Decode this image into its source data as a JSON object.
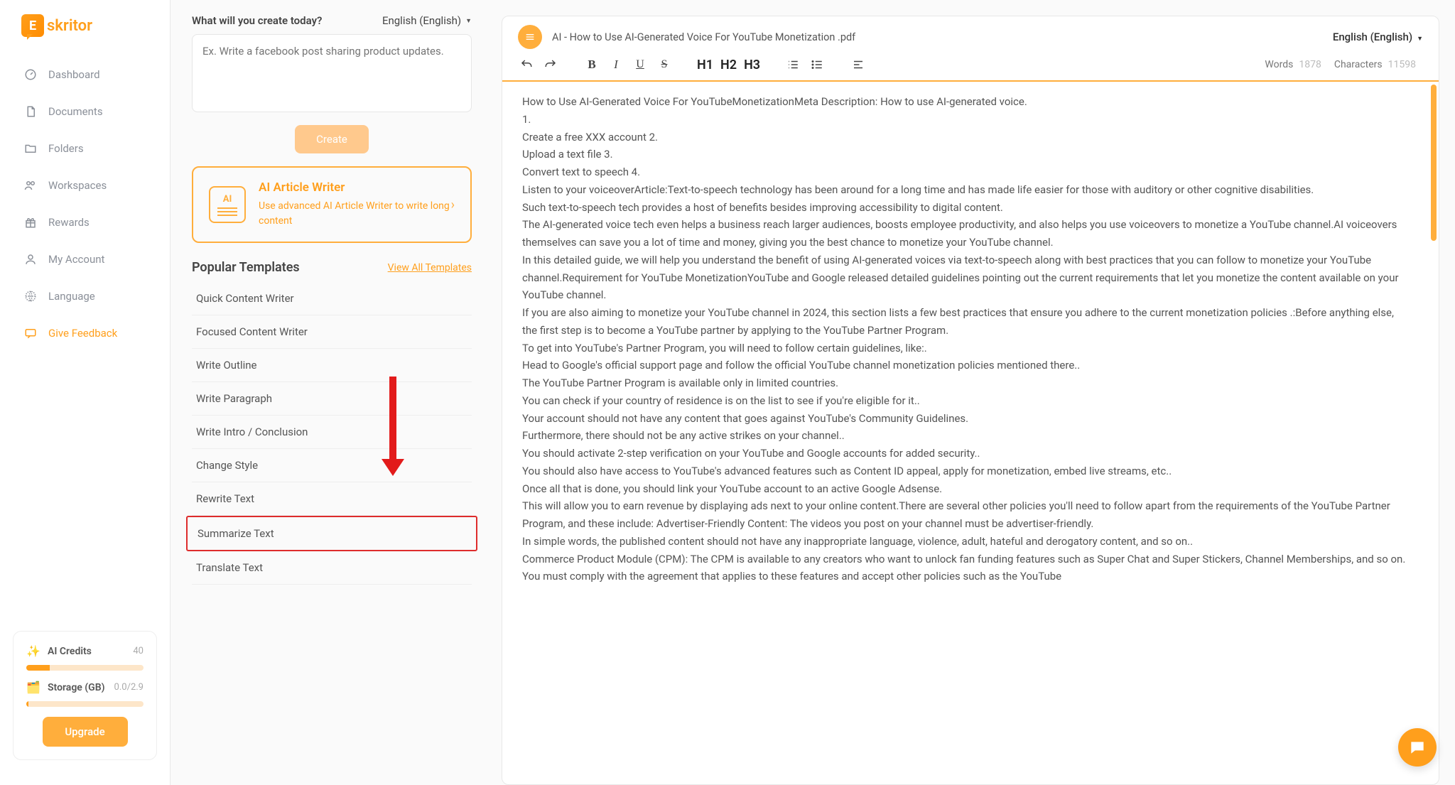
{
  "brand": {
    "mark": "E",
    "name": "skritor"
  },
  "sidebar": {
    "items": [
      {
        "label": "Dashboard"
      },
      {
        "label": "Documents"
      },
      {
        "label": "Folders"
      },
      {
        "label": "Workspaces"
      },
      {
        "label": "Rewards"
      },
      {
        "label": "My Account"
      },
      {
        "label": "Language"
      },
      {
        "label": "Give Feedback"
      }
    ],
    "credits": {
      "ai_label": "AI Credits",
      "ai_value": "40",
      "storage_label": "Storage (GB)",
      "storage_value": "0.0/2.9",
      "upgrade": "Upgrade"
    }
  },
  "mid": {
    "prompt_title": "What will you create today?",
    "language": "English (English)",
    "placeholder": "Ex. Write a facebook post sharing product updates.",
    "create": "Create",
    "writer": {
      "title": "AI Article Writer",
      "desc": "Use advanced AI Article Writer to write long content"
    },
    "templates_title": "Popular Templates",
    "view_all": "View All Templates",
    "templates": [
      {
        "label": "Quick Content Writer"
      },
      {
        "label": "Focused Content Writer"
      },
      {
        "label": "Write Outline"
      },
      {
        "label": "Write Paragraph"
      },
      {
        "label": "Write Intro / Conclusion"
      },
      {
        "label": "Change Style"
      },
      {
        "label": "Rewrite Text"
      },
      {
        "label": "Summarize Text",
        "highlight": true
      },
      {
        "label": "Translate Text"
      }
    ]
  },
  "editor": {
    "title": "AI - How to Use AI-Generated Voice For YouTube Monetization .pdf",
    "language": "English (English)",
    "headings": [
      "H1",
      "H2",
      "H3"
    ],
    "stats": {
      "words_lbl": "Words",
      "words": "1878",
      "chars_lbl": "Characters",
      "chars": "11598"
    },
    "body": "How to Use AI-Generated Voice For YouTubeMonetizationMeta Description: How to use AI-generated voice.\n1.\nCreate a free XXX account 2.\nUpload a text file 3.\nConvert text to speech 4.\nListen to your voiceoverArticle:Text-to-speech technology has been around for a long time and has made life easier for those with auditory or other cognitive disabilities.\nSuch text-to-speech tech provides a host of benefits besides improving accessibility to digital content.\nThe AI-generated voice tech even helps a business reach larger audiences, boosts employee productivity, and also helps you use voiceovers to monetize a YouTube channel.AI voiceovers themselves can save you a lot of time and money, giving you the best chance to monetize your YouTube channel.\nIn this detailed guide, we will help you understand the benefit of using AI-generated voices via text-to-speech along with best practices that you can follow to monetize your YouTube channel.Requirement for YouTube MonetizationYouTube and Google released detailed guidelines pointing out the current requirements that let you monetize the content available on your YouTube channel.\nIf you are also aiming to monetize your YouTube channel in 2024, this section lists a few best practices that ensure you adhere to the current monetization policies .:Before anything else, the first step is to become a YouTube partner by applying to the YouTube Partner Program.\nTo get into YouTube's Partner Program, you will need to follow certain guidelines, like:.\nHead to Google's official support page and follow the official YouTube channel monetization policies mentioned there..\nThe YouTube Partner Program is available only in limited countries.\nYou can check if your country of residence is on the list to see if you're eligible for it..\nYour account should not have any content that goes against YouTube's Community Guidelines.\nFurthermore, there should not be any active strikes on your channel..\nYou should activate 2-step verification on your YouTube and Google accounts for added security..\nYou should also have access to YouTube's advanced features such as Content ID appeal, apply for monetization, embed live streams, etc..\nOnce all that is done, you should link your YouTube account to an active Google Adsense.\nThis will allow you to earn revenue by displaying ads next to your online content.There are several other policies you'll need to follow apart from the requirements of the YouTube Partner Program, and these include: Advertiser-Friendly Content: The videos you post on your channel must be advertiser-friendly.\nIn simple words, the published content should not have any inappropriate language, violence, adult, hateful and derogatory content, and so on..\nCommerce Product Module (CPM): The CPM is available to any creators who want to unlock fan funding features such as Super Chat and Super Stickers, Channel Memberships, and so on.\nYou must comply with the agreement that applies to these features and accept other policies such as the YouTube"
  }
}
